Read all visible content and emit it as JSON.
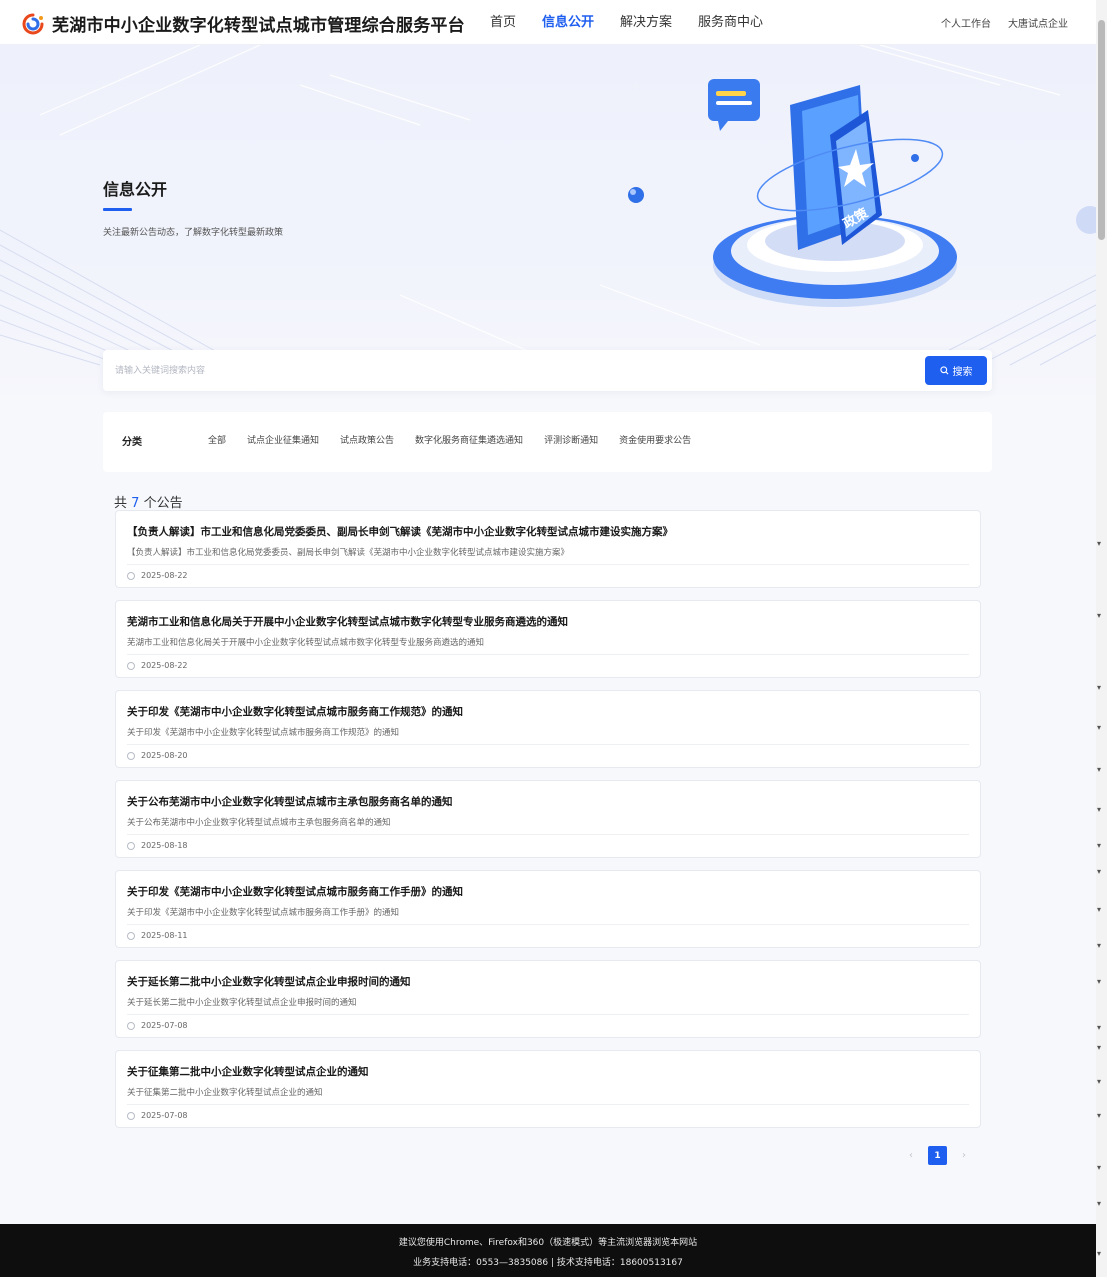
{
  "header": {
    "site_title": "芜湖市中小企业数字化转型试点城市管理综合服务平台",
    "nav": [
      {
        "label": "首页",
        "active": false
      },
      {
        "label": "信息公开",
        "active": true
      },
      {
        "label": "解决方案",
        "active": false
      },
      {
        "label": "服务商中心",
        "active": false
      }
    ],
    "right_links": [
      "个人工作台",
      "大唐试点企业"
    ]
  },
  "hero": {
    "title": "信息公开",
    "subtitle": "关注最新公告动态，了解数字化转型最新政策",
    "art_badge": "政策"
  },
  "search": {
    "placeholder": "请输入关键词搜索内容",
    "button_label": "搜索"
  },
  "category": {
    "label": "分类",
    "items": [
      "全部",
      "试点企业征集通知",
      "试点政策公告",
      "数字化服务商征集遴选通知",
      "评测诊断通知",
      "资金使用要求公告"
    ]
  },
  "count": {
    "prefix": "共",
    "value": "7",
    "suffix": "个公告"
  },
  "notices": [
    {
      "title": "【负责人解读】市工业和信息化局党委委员、副局长申剑飞解读《芜湖市中小企业数字化转型试点城市建设实施方案》",
      "summary": "【负责人解读】市工业和信息化局党委委员、副局长申剑飞解读《芜湖市中小企业数字化转型试点城市建设实施方案》",
      "date": "2025-08-22"
    },
    {
      "title": "芜湖市工业和信息化局关于开展中小企业数字化转型试点城市数字化转型专业服务商遴选的通知",
      "summary": "芜湖市工业和信息化局关于开展中小企业数字化转型试点城市数字化转型专业服务商遴选的通知",
      "date": "2025-08-22"
    },
    {
      "title": "关于印发《芜湖市中小企业数字化转型试点城市服务商工作规范》的通知",
      "summary": "关于印发《芜湖市中小企业数字化转型试点城市服务商工作规范》的通知",
      "date": "2025-08-20"
    },
    {
      "title": "关于公布芜湖市中小企业数字化转型试点城市主承包服务商名单的通知",
      "summary": "关于公布芜湖市中小企业数字化转型试点城市主承包服务商名单的通知",
      "date": "2025-08-18"
    },
    {
      "title": "关于印发《芜湖市中小企业数字化转型试点城市服务商工作手册》的通知",
      "summary": "关于印发《芜湖市中小企业数字化转型试点城市服务商工作手册》的通知",
      "date": "2025-08-11"
    },
    {
      "title": "关于延长第二批中小企业数字化转型试点企业申报时间的通知",
      "summary": "关于延长第二批中小企业数字化转型试点企业申报时间的通知",
      "date": "2025-07-08"
    },
    {
      "title": "关于征集第二批中小企业数字化转型试点企业的通知",
      "summary": "关于征集第二批中小企业数字化转型试点企业的通知",
      "date": "2025-07-08"
    }
  ],
  "pagination": {
    "prev": "‹",
    "current": "1",
    "next": "›"
  },
  "footer": {
    "line1": "建议您使用Chrome、Firefox和360（极速模式）等主流浏览器浏览本网站",
    "line2": "业务支持电话：0553—3835086 | 技术支持电话：18600513167"
  },
  "colors": {
    "primary": "#1f5ff0",
    "footer_bg": "#0e0e0e"
  }
}
